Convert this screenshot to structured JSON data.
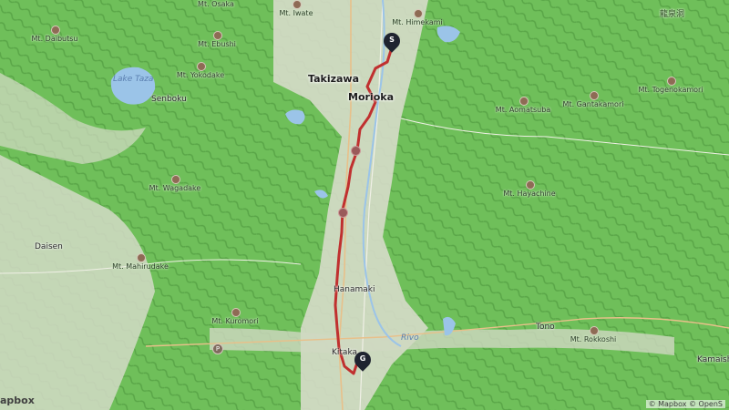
{
  "map": {
    "cities": {
      "takizawa": "Takizawa",
      "morioka": "Morioka",
      "hanamaki": "Hanamaki",
      "tono": "Tono",
      "kitakami": "Kitaka",
      "daisen": "Daisen",
      "senboku": "Senboku",
      "kamaishi": "Kamaish"
    },
    "water": {
      "lake_tazawa": "Lake Taza",
      "river": "Rivo"
    },
    "mountains": {
      "osaka": "Mt. Osaka",
      "iwate": "Mt. Iwate",
      "himekami": "Mt. Himekami",
      "daibutsu": "Mt. Daibutsu",
      "ebushi": "Mt. Ebushi",
      "yokodake": "Mt. Yokodake",
      "togenokamori": "Mt. Togenokamori",
      "gantakamori": "Mt. Gantakamori",
      "aomatsuba": "Mt. Aomatsuba",
      "wagadake": "Mt. Wagadake",
      "hayachine": "Mt. Hayachine",
      "mahirudake": "Mt. Mahirudake",
      "kuromori": "Mt. Kuromori",
      "rokkoshi": "Mt. Rokkoshi"
    },
    "top_right_label": "龍泉洞",
    "markers": {
      "start": "S",
      "goal": "G"
    },
    "park_symbol": "P",
    "attribution": "© Mapbox © OpenS",
    "logo": "apbox",
    "colors": {
      "route": "#c0302f",
      "land": "#6fbf5a",
      "valley": "#d8dccf",
      "water": "#9bc4e8",
      "marker": "#1f2430"
    }
  }
}
